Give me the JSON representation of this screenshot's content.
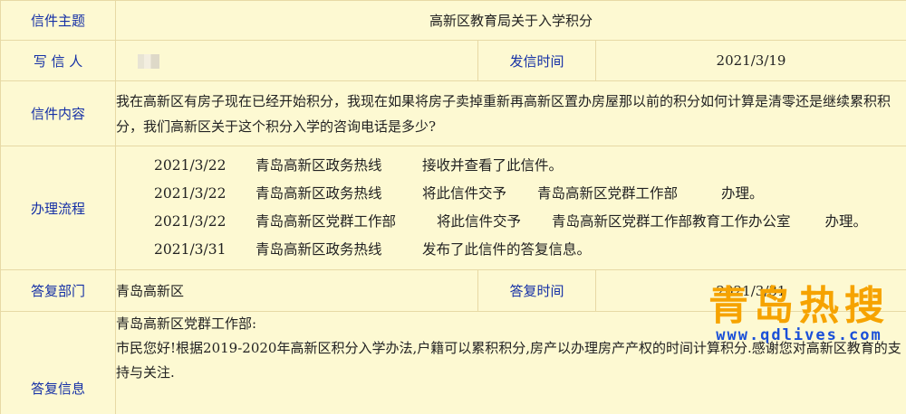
{
  "labels": {
    "subject": "信件主题",
    "writer": "写 信 人",
    "send_time": "发信时间",
    "content": "信件内容",
    "process": "办理流程",
    "reply_dept": "答复部门",
    "reply_time": "答复时间",
    "reply_info": "答复信息"
  },
  "letter": {
    "subject": "高新区教育局关于入学积分",
    "send_time": "2021/3/19",
    "content": "我在高新区有房子现在已经开始积分，我现在如果将房子卖掉重新再高新区置办房屋那以前的积分如何计算是清零还是继续累积积分，我们高新区关于这个积分入学的咨询电话是多少?"
  },
  "process": [
    {
      "date": "2021/3/22",
      "org": "青岛高新区政务热线",
      "action": "接收并查看了此信件。",
      "target": "",
      "suffix": ""
    },
    {
      "date": "2021/3/22",
      "org": "青岛高新区政务热线",
      "action": "将此信件交予",
      "target": "青岛高新区党群工作部",
      "suffix": "办理。"
    },
    {
      "date": "2021/3/22",
      "org": "青岛高新区党群工作部",
      "action": "将此信件交予",
      "target": "青岛高新区党群工作部教育工作办公室",
      "suffix": "办理。"
    },
    {
      "date": "2021/3/31",
      "org": "青岛高新区政务热线",
      "action": "发布了此信件的答复信息。",
      "target": "",
      "suffix": ""
    }
  ],
  "reply": {
    "dept": "青岛高新区",
    "time": "2021/3/31",
    "greeting": "青岛高新区党群工作部:",
    "body": "市民您好!根据2019-2020年高新区积分入学办法,户籍可以累积积分,房产以办理房产产权的时间计算积分.感谢您对高新区教育的支持与关注."
  },
  "watermark": {
    "title": "青岛热搜",
    "url": "www.qdlives.com"
  },
  "colors": {
    "background": "#fdf9d2",
    "label": "#1530a6",
    "border": "#e7d9a5",
    "watermark_title": "#f6a300",
    "watermark_url": "#1a4fd8"
  }
}
